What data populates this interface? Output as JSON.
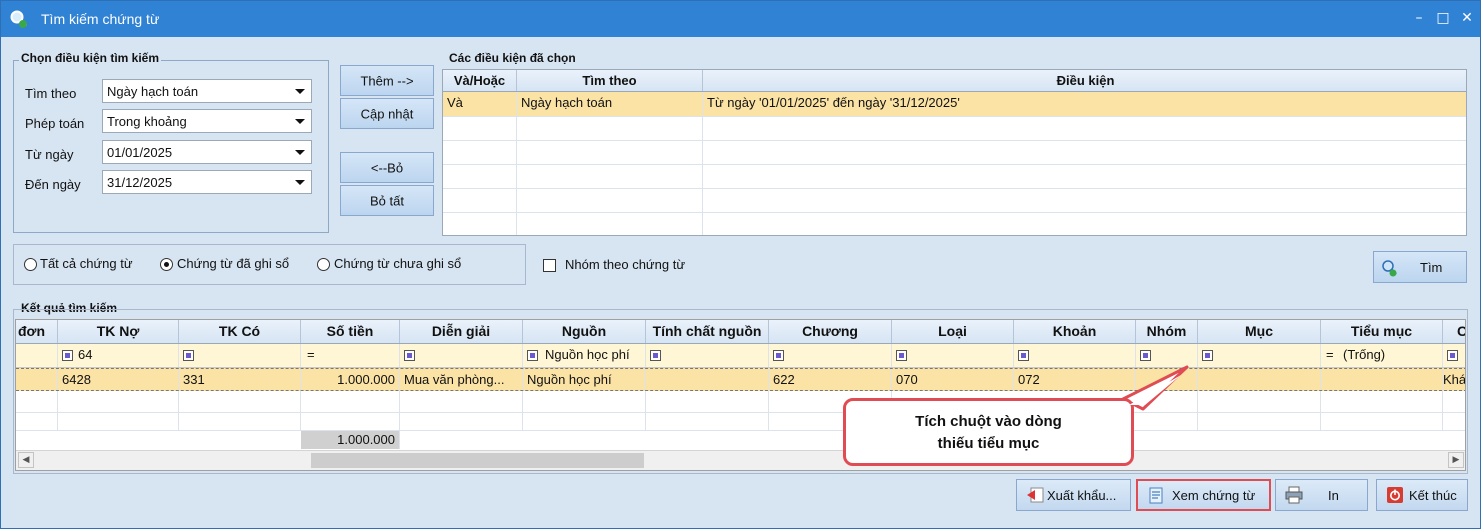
{
  "window": {
    "title": "Tìm kiếm chứng từ",
    "controls": [
      "–",
      "□",
      "✕"
    ]
  },
  "criteria_group": {
    "title": "Chọn điều kiện tìm kiếm",
    "fields": [
      {
        "label": "Tìm theo",
        "value": "Ngày hạch toán"
      },
      {
        "label": "Phép toán",
        "value": "Trong khoảng"
      },
      {
        "label": "Từ ngày",
        "value": "01/01/2025"
      },
      {
        "label": "Đến ngày",
        "value": "31/12/2025"
      }
    ]
  },
  "action_buttons": {
    "add": "Thêm -->",
    "update": "Cập nhật",
    "remove": "<--Bỏ",
    "remove_all": "Bỏ tất"
  },
  "selected_group": {
    "title": "Các điều kiện đã chọn",
    "headers": [
      "Và/Hoặc",
      "Tìm theo",
      "Điều kiện"
    ],
    "rows": [
      {
        "andor": "Và",
        "field": "Ngày hạch toán",
        "condition": "Từ ngày '01/01/2025' đến ngày '31/12/2025'"
      }
    ]
  },
  "filter_options": {
    "radios": [
      {
        "label": "Tất cả chứng từ",
        "checked": false
      },
      {
        "label": "Chứng từ đã ghi sổ",
        "checked": true
      },
      {
        "label": "Chứng từ chưa ghi sổ",
        "checked": false
      }
    ],
    "group_by_label": "Nhóm theo chứng từ",
    "group_by_checked": false,
    "search_button": "Tìm"
  },
  "results": {
    "title": "Kết quả tìm kiếm",
    "headers": [
      "đơn",
      "TK Nợ",
      "TK Có",
      "Số tiền",
      "Diễn giải",
      "Nguồn",
      "Tính chất nguồn",
      "Chương",
      "Loại",
      "Khoản",
      "Nhóm",
      "Mục",
      "Tiểu mục",
      "C"
    ],
    "filter_row": {
      "tk_no": "64",
      "so_tien_op": "=",
      "nguon": "Nguồn học phí",
      "tieu_muc_op": "=",
      "tieu_muc": "(Trống)"
    },
    "rows": [
      {
        "tk_no": "6428",
        "tk_co": "331",
        "so_tien": "1.000.000",
        "dien_giai": "Mua văn phòng...",
        "nguon": "Nguồn học phí",
        "chuong": "622",
        "loai": "070",
        "khoan": "072",
        "last": "Khá"
      }
    ],
    "total": "1.000.000"
  },
  "callout": {
    "line1": "Tích chuột vào dòng",
    "line2": "thiếu tiểu mục"
  },
  "bottom_buttons": {
    "export": "Xuất khẩu...",
    "view": "Xem chứng từ",
    "print": "In",
    "close": "Kết thúc"
  },
  "colors": {
    "titlebar": "#2f82d4",
    "background": "#d7e4f2",
    "selected_row": "#fbe3a6",
    "callout_border": "#e04c53"
  }
}
